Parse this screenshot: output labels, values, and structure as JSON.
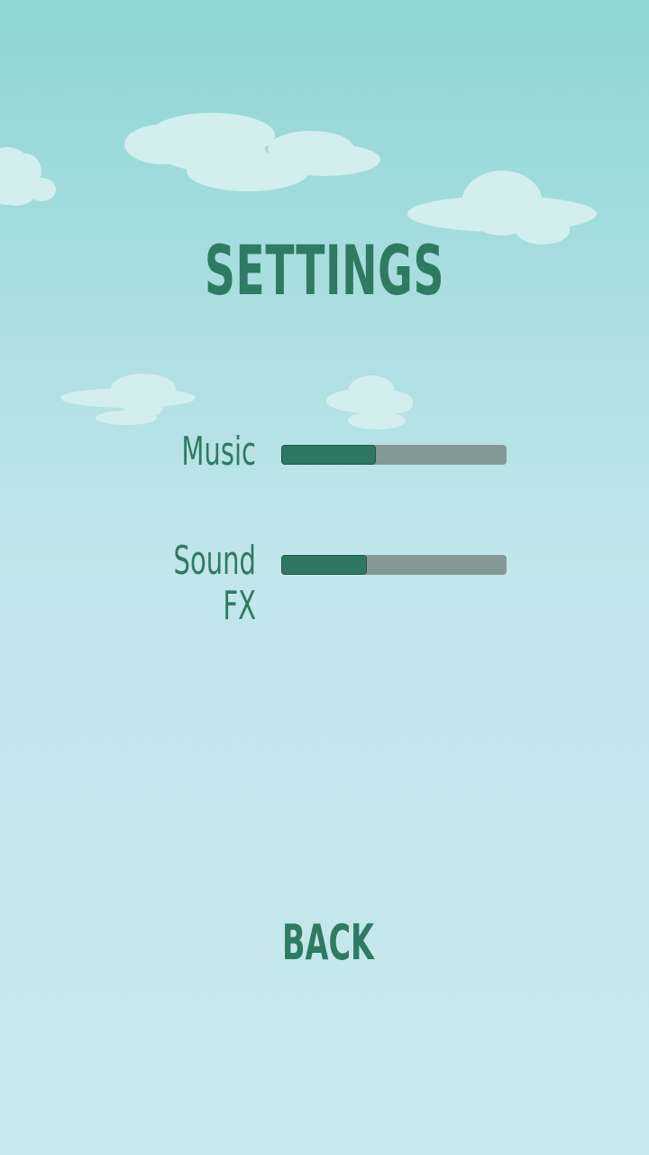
{
  "screen": {
    "title": "SETTINGS",
    "back_label": "BACK"
  },
  "settings": {
    "music": {
      "label": "Music",
      "level": 0.42
    },
    "sound_fx": {
      "label": "Sound FX",
      "level": 0.38
    }
  },
  "colors": {
    "text": "#2f7a62",
    "slider_fill": "#2e7762",
    "slider_track": "#849897",
    "cloud": "#d2eeef",
    "sky_top": "#8ed6d2",
    "sky_bottom": "#c7e8ed"
  }
}
